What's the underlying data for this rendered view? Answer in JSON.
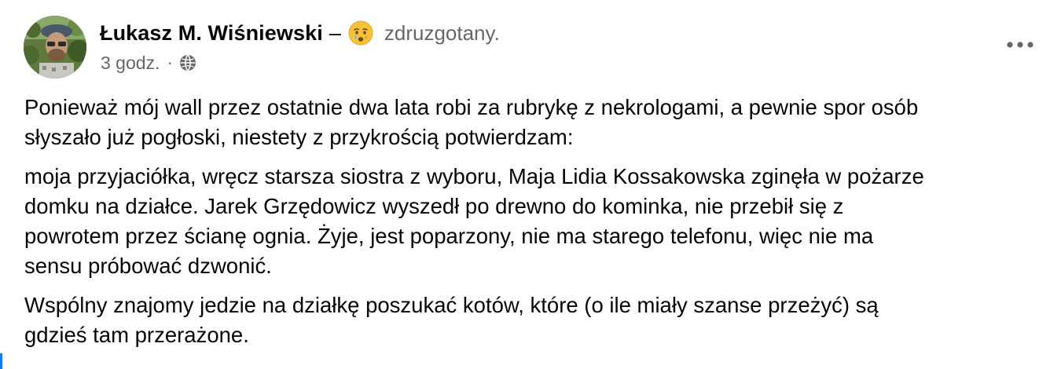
{
  "post": {
    "author": "Łukasz M. Wiśniewski",
    "separator": "–",
    "feeling": {
      "emoji_icon": "crying-face-emoji-icon",
      "text": "zdruzgotany."
    },
    "time": "3 godz.",
    "meta_separator": "·",
    "privacy_icon": "globe-icon",
    "more_icon": "more-options-icon",
    "paragraphs": [
      "Ponieważ mój wall przez ostatnie dwa lata robi za rubrykę z nekrologami, a pewnie spor osób\nsłyszało już pogłoski, niestety z przykrością potwierdzam:",
      "moja przyjaciółka, wręcz starsza siostra z wyboru, Maja Lidia Kossakowska zginęła w pożarze\ndomku na działce. Jarek Grzędowicz wyszedł po drewno do kominka, nie przebił się  z\npowrotem przez ścianę ognia. Żyje, jest poparzony, nie ma starego telefonu, więc nie ma\nsensu próbować dzwonić.",
      "Wspólny znajomy jedzie na działkę poszukać kotów, które (o ile miały szanse przeżyć) są\ngdzieś tam przerażone."
    ]
  },
  "colors": {
    "primary_text": "#050505",
    "secondary_text": "#65676b",
    "accent": "#1877f2"
  }
}
